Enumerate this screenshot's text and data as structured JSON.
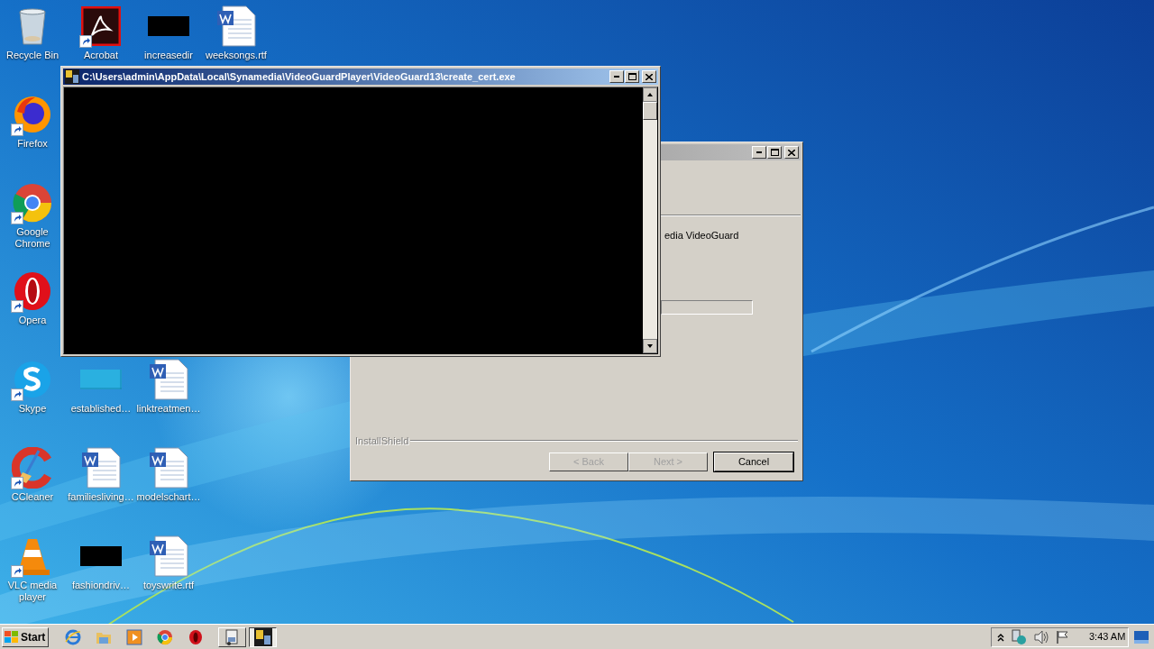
{
  "desktop": {
    "icons": [
      {
        "label": "Recycle Bin",
        "kind": "recycle",
        "shortcut": false
      },
      {
        "label": "Acrobat",
        "kind": "acrobat",
        "shortcut": true
      },
      {
        "label": "increasedir",
        "kind": "blank",
        "shortcut": false
      },
      {
        "label": "weeksongs.rtf",
        "kind": "word",
        "shortcut": false
      },
      {
        "label": "Firefox",
        "kind": "firefox",
        "shortcut": true
      },
      {
        "label": "Google Chrome",
        "kind": "chrome",
        "shortcut": true
      },
      {
        "label": "Opera",
        "kind": "opera",
        "shortcut": true
      },
      {
        "label": "Skype",
        "kind": "skype",
        "shortcut": true
      },
      {
        "label": "established…",
        "kind": "thin",
        "shortcut": false
      },
      {
        "label": "linktreatmen…",
        "kind": "word",
        "shortcut": false
      },
      {
        "label": "CCleaner",
        "kind": "ccleaner",
        "shortcut": true
      },
      {
        "label": "familiesliving…",
        "kind": "word",
        "shortcut": false
      },
      {
        "label": "modelschart…",
        "kind": "word",
        "shortcut": false
      },
      {
        "label": "VLC media player",
        "kind": "vlc",
        "shortcut": true
      },
      {
        "label": "fashiondriv…",
        "kind": "blank",
        "shortcut": false
      },
      {
        "label": "toyswrite.rtf",
        "kind": "word",
        "shortcut": false
      }
    ]
  },
  "installer": {
    "active": false,
    "progress": {
      "level": 0
    },
    "text": "edia VideoGuard",
    "brand": "InstallShield",
    "buttons": [
      {
        "label": "< Back",
        "disabled": true,
        "default": false
      },
      {
        "label": "Next >",
        "disabled": true,
        "default": false
      },
      {
        "label": "Cancel",
        "disabled": false,
        "default": true
      }
    ]
  },
  "console": {
    "active": true,
    "title": "C:\\Users\\admin\\AppData\\Local\\Synamedia\\VideoGuardPlayer\\VideoGuard13\\create_cert.exe"
  },
  "taskbar": {
    "start": "Start",
    "quick_launch": [
      {
        "kind": "ie"
      },
      {
        "kind": "folder"
      },
      {
        "kind": "media"
      },
      {
        "kind": "chrome"
      },
      {
        "kind": "opera"
      }
    ],
    "tasks": [
      {
        "kind": "installer",
        "selected": false
      },
      {
        "kind": "console",
        "selected": true
      }
    ],
    "tray": {
      "icons": [
        {
          "kind": "chevron"
        },
        {
          "kind": "network"
        },
        {
          "kind": "volume"
        },
        {
          "kind": "flag"
        }
      ],
      "clock": "3:43 AM"
    }
  }
}
